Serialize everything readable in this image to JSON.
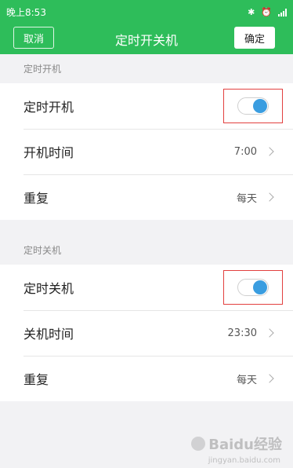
{
  "status_bar": {
    "time": "晚上8:53",
    "bluetooth_icon": "bluetooth-icon",
    "alarm_icon": "alarm-icon",
    "signal_icon": "signal-icon"
  },
  "navbar": {
    "cancel_label": "取消",
    "title": "定时开关机",
    "confirm_label": "确定"
  },
  "power_on": {
    "header": "定时开机",
    "toggle_label": "定时开机",
    "toggle_on": true,
    "time_label": "开机时间",
    "time_value": "7:00",
    "repeat_label": "重复",
    "repeat_value": "每天"
  },
  "power_off": {
    "header": "定时关机",
    "toggle_label": "定时关机",
    "toggle_on": true,
    "time_label": "关机时间",
    "time_value": "23:30",
    "repeat_label": "重复",
    "repeat_value": "每天"
  },
  "watermark": {
    "text": "Baidu经验",
    "sub": "jingyan.baidu.com"
  },
  "colors": {
    "header_green": "#2ebd5a",
    "toggle_blue": "#3a9de0",
    "highlight_red": "#e2403f"
  }
}
